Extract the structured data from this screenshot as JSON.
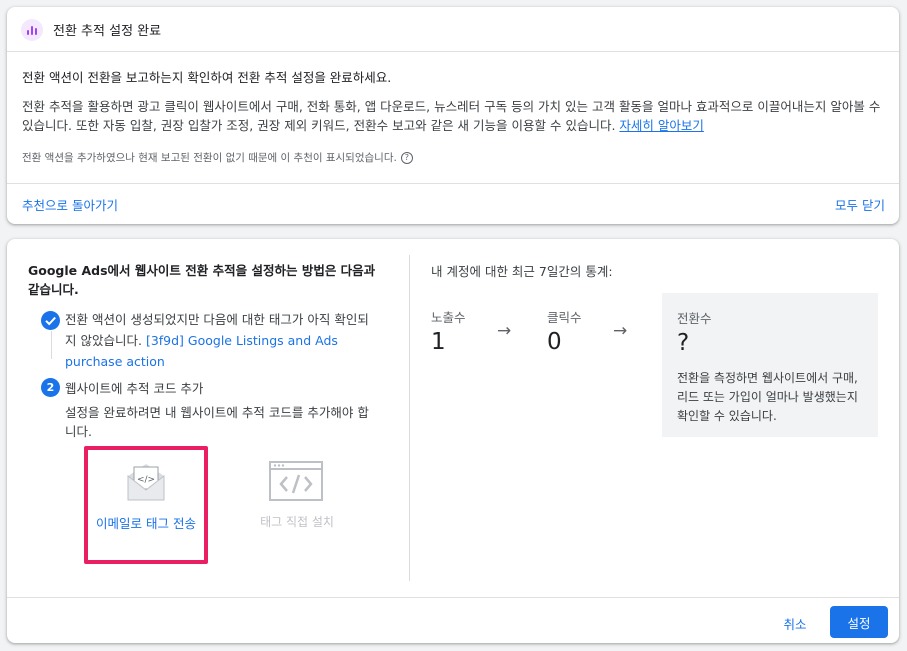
{
  "notice": {
    "title": "전환 추적 설정 완료",
    "heading": "전환 액션이 전환을 보고하는지 확인하여 전환 추적 설정을 완료하세요.",
    "body": "전환 추적을 활용하면 광고 클릭이 웹사이트에서 구매, 전화 통화, 앱 다운로드, 뉴스레터 구독 등의 가치 있는 고객 활동을 얼마나 효과적으로 이끌어내는지 알아볼 수 있습니다. 또한 자동 입찰, 권장 입찰가 조정, 권장 제외 키워드, 전환수 보고와 같은 새 기능을 이용할 수 있습니다.",
    "learn_more": "자세히 알아보기",
    "note": "전환 액션을 추가하였으나 현재 보고된 전환이 없기 때문에 이 추천이 표시되었습니다.",
    "help_glyph": "?",
    "back_link": "추천으로 돌아가기",
    "close_all": "모두 닫기",
    "icon": "bar-chart-icon",
    "icon_color": "#a142f4"
  },
  "setup": {
    "title": "Google Ads에서 웹사이트 전환 추적을 설정하는 방법은 다음과 같습니다.",
    "step1": {
      "text": "전환 액션이 생성되었지만 다음에 대한 태그가 아직 확인되지 않았습니다.",
      "link": "[3f9d] Google Listings and Ads purchase action"
    },
    "step2": {
      "number": "2",
      "title": "웹사이트에 추적 코드 추가",
      "text": "설정을 완료하려면 내 웹사이트에 추적 코드를 추가해야 합니다."
    },
    "options": {
      "email": {
        "label": "이메일로 태그 전송",
        "icon": "email-code-icon"
      },
      "direct": {
        "label": "태그 직접 설치",
        "icon": "browser-code-icon"
      }
    }
  },
  "stats": {
    "title": "내 계정에 대한 최근 7일간의 통계:",
    "impressions": {
      "label": "노출수",
      "value": "1"
    },
    "clicks": {
      "label": "클릭수",
      "value": "0"
    },
    "conversions": {
      "label": "전환수",
      "value": "?",
      "desc": "전환을 측정하면 웹사이트에서 구매, 리드 또는 가입이 얼마나 발생했는지 확인할 수 있습니다."
    },
    "arrow_glyph": "→"
  },
  "footer": {
    "cancel": "취소",
    "setup": "설정"
  },
  "colors": {
    "accent": "#1a73e8",
    "highlight": "#e91e63"
  }
}
